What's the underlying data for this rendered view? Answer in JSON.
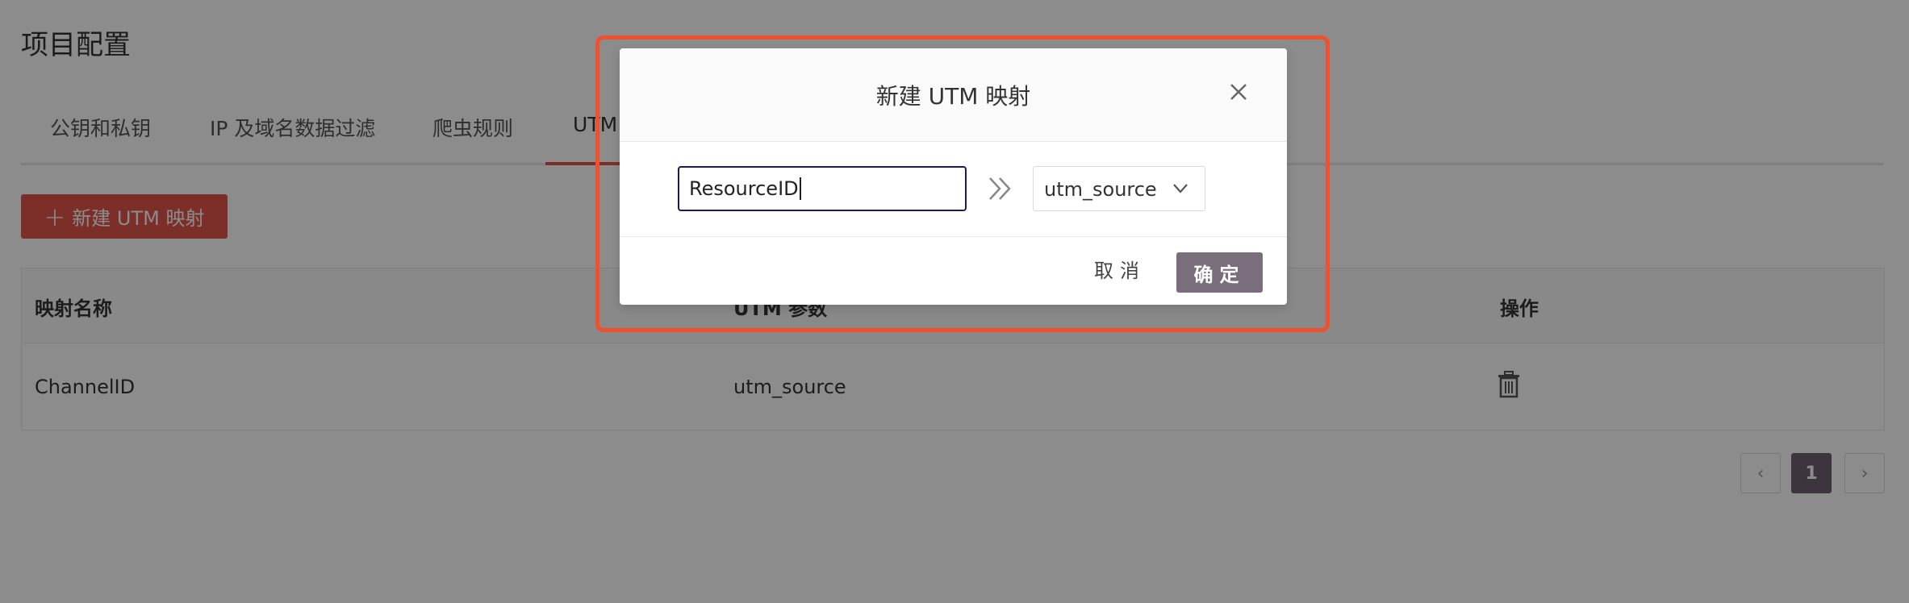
{
  "page": {
    "title": "项目配置"
  },
  "tabs": [
    {
      "label": "公钥和私钥"
    },
    {
      "label": "IP 及域名数据过滤"
    },
    {
      "label": "爬虫规则"
    },
    {
      "label": "UTM",
      "active": true
    }
  ],
  "toolbar": {
    "new_label": "新建 UTM 映射",
    "plus_icon": "plus-icon"
  },
  "table": {
    "columns": [
      "映射名称",
      "UTM 参数",
      "操作"
    ],
    "rows": [
      {
        "name": "ChannelID",
        "param": "utm_source",
        "action_icon": "trash-icon"
      }
    ]
  },
  "pagination": {
    "prev_icon": "chevron-left-icon",
    "current": "1",
    "next_icon": "chevron-right-icon"
  },
  "modal": {
    "title": "新建 UTM 映射",
    "close_icon": "close-icon",
    "name_value": "ResourceID",
    "arrow_icon": "double-chevron-right-icon",
    "select_value": "utm_source",
    "cancel_label": "取消",
    "ok_label": "确定"
  },
  "colors": {
    "accent": "#e2574c",
    "primary_button": "#7a6e7d",
    "highlight_border": "#f1502f",
    "overlay": "rgba(0,0,0,0.45)"
  }
}
